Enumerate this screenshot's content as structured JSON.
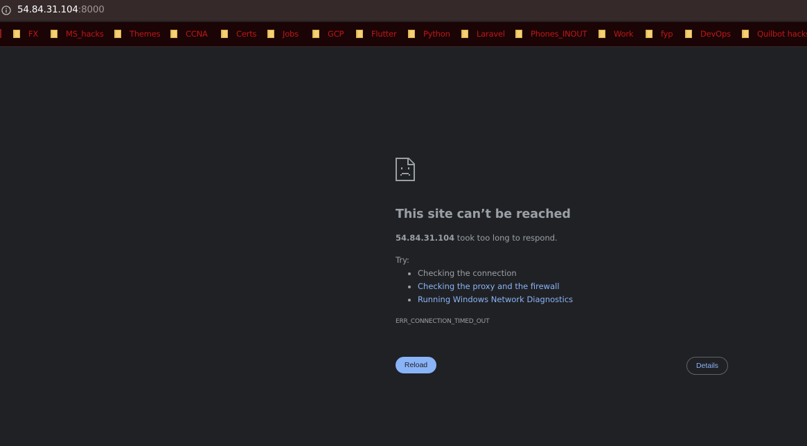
{
  "address_bar": {
    "host": "54.84.31.104",
    "port": ":8000"
  },
  "bookmarks": [
    {
      "label": "FX",
      "icon": "folder-icon"
    },
    {
      "label": "MS_hacks",
      "icon": "folder-icon"
    },
    {
      "label": "Themes",
      "icon": "folder-icon"
    },
    {
      "label": "CCNA",
      "icon": "folder-icon"
    },
    {
      "label": "Certs",
      "icon": "folder-icon"
    },
    {
      "label": "Jobs",
      "icon": "folder-icon"
    },
    {
      "label": "GCP",
      "icon": "folder-icon"
    },
    {
      "label": "Flutter",
      "icon": "folder-icon"
    },
    {
      "label": "Python",
      "icon": "folder-icon"
    },
    {
      "label": "Laravel",
      "icon": "folder-icon"
    },
    {
      "label": "Phones_INOUT",
      "icon": "folder-icon"
    },
    {
      "label": "Work",
      "icon": "folder-icon"
    },
    {
      "label": "fyp",
      "icon": "folder-icon"
    },
    {
      "label": "DevOps",
      "icon": "folder-icon"
    },
    {
      "label": "Quilbot hacks",
      "icon": "folder-icon"
    }
  ],
  "error": {
    "icon": "sad-page-icon",
    "title": "This site can’t be reached",
    "host": "54.84.31.104",
    "description_suffix": " took too long to respond.",
    "try_label": "Try:",
    "suggestions": [
      {
        "text": "Checking the connection",
        "is_link": false
      },
      {
        "text": "Checking the proxy and the firewall",
        "is_link": true
      },
      {
        "text": "Running Windows Network Diagnostics",
        "is_link": true
      }
    ],
    "code": "ERR_CONNECTION_TIMED_OUT"
  },
  "buttons": {
    "reload": "Reload",
    "details": "Details"
  },
  "colors": {
    "page_background": "#202124",
    "address_bar_background": "#35292a",
    "bookmarks_background": "#1a0405",
    "bookmark_text": "#c01719",
    "folder_icon": "#f5d176",
    "text_secondary": "#9aa0a6",
    "link": "#8ab4f8",
    "reload_button": "#8ab4f8"
  }
}
